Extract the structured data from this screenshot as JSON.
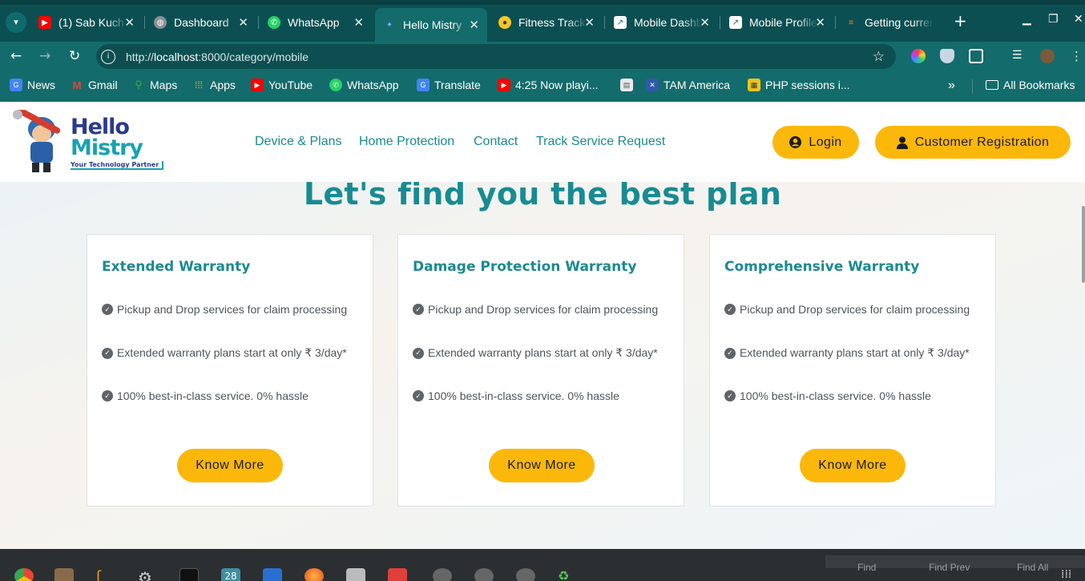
{
  "browser": {
    "tabs": [
      {
        "title": "(1) Sab Kuch",
        "favicon": "youtube-icon",
        "color": "#ff0000"
      },
      {
        "title": "Dashboard",
        "favicon": "globe-icon",
        "color": "#8a8f92"
      },
      {
        "title": "WhatsApp",
        "favicon": "whatsapp-icon",
        "color": "#25d366"
      },
      {
        "title": "Hello Mistry",
        "favicon": "hello-mistry-icon",
        "color": "#2b7fd4",
        "active": true
      },
      {
        "title": "Fitness Tracker",
        "favicon": "fitness-icon",
        "color": "#f7c52b"
      },
      {
        "title": "Mobile Dashboard",
        "favicon": "chart-icon",
        "color": "#ffffff"
      },
      {
        "title": "Mobile Profile",
        "favicon": "chart-icon",
        "color": "#ffffff"
      },
      {
        "title": "Getting current",
        "favicon": "stackoverflow-icon",
        "color": "#f48024"
      }
    ],
    "url_prefix": "http://",
    "url_host": "localhost",
    "url_rest": ":8000/category/mobile",
    "bookmarks": [
      {
        "label": "News",
        "icon": "google-news-icon",
        "color": "#4285f4"
      },
      {
        "label": "Gmail",
        "icon": "gmail-icon",
        "color": "#ea4335"
      },
      {
        "label": "Maps",
        "icon": "maps-icon",
        "color": "#34a853"
      },
      {
        "label": "Apps",
        "icon": "apps-grid-icon",
        "color": "#fbbc04"
      },
      {
        "label": "YouTube",
        "icon": "youtube-icon",
        "color": "#ff0000"
      },
      {
        "label": "WhatsApp",
        "icon": "whatsapp-icon",
        "color": "#25d366"
      },
      {
        "label": "Translate",
        "icon": "translate-icon",
        "color": "#4285f4"
      },
      {
        "label": "4:25 Now playi...",
        "icon": "youtube-icon",
        "color": "#ff0000"
      },
      {
        "label": "",
        "icon": "document-icon",
        "color": "#e8eaed"
      },
      {
        "label": "TAM America",
        "icon": "tam-icon",
        "color": "#2e5aa8"
      },
      {
        "label": "PHP sessions i...",
        "icon": "php-icon",
        "color": "#f0c419"
      }
    ],
    "all_bookmarks": "All Bookmarks"
  },
  "site": {
    "logo": {
      "line1": "Hello",
      "line2": "Mistry",
      "tagline": "Your Technology Partner"
    },
    "nav": [
      "Device & Plans",
      "Home Protection",
      "Contact",
      "Track Service Request"
    ],
    "login": "Login",
    "register": "Customer Registration",
    "headline": "Let's find you the best plan",
    "plans": [
      {
        "title": "Extended Warranty",
        "features": [
          "Pickup and Drop services for claim processing",
          "Extended warranty plans start at only ₹ 3/day*",
          "100% best-in-class service. 0% hassle"
        ],
        "cta": "Know More"
      },
      {
        "title": "Damage Protection Warranty",
        "features": [
          "Pickup and Drop services for claim processing",
          "Extended warranty plans start at only ₹ 3/day*",
          "100% best-in-class service. 0% hassle"
        ],
        "cta": "Know More"
      },
      {
        "title": "Comprehensive Warranty",
        "features": [
          "Pickup and Drop services for claim processing",
          "Extended warranty plans start at only ₹ 3/day*",
          "100% best-in-class service. 0% hassle"
        ],
        "cta": "Know More"
      }
    ]
  },
  "taskbar": {
    "calendar_day": "28",
    "find": "Find",
    "find_prev": "Find Prev",
    "find_all": "Find All"
  },
  "colors": {
    "brand_teal": "#188b92",
    "accent_yellow": "#fbb80b",
    "chrome_teal": "#146b6b"
  }
}
